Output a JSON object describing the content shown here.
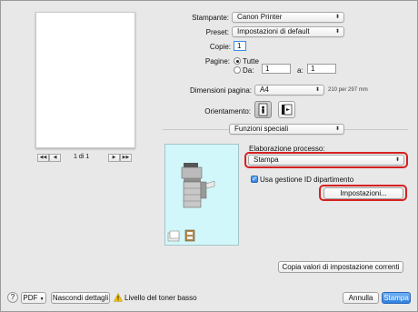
{
  "printer": {
    "label": "Stampante:",
    "value": "Canon Printer"
  },
  "preset": {
    "label": "Preset:",
    "value": "Impostazioni di default"
  },
  "copies": {
    "label": "Copie:",
    "value": "1"
  },
  "pages": {
    "label": "Pagine:",
    "all_label": "Tutte",
    "from_label": "Da:",
    "from_value": "1",
    "to_label": "a:",
    "to_value": "1",
    "selected": "Tutte"
  },
  "paper": {
    "label": "Dimensioni pagina:",
    "value": "A4",
    "size_text": "210 per 297 mm"
  },
  "orientation": {
    "label": "Orientamento:",
    "selected": "portrait"
  },
  "section_popup": {
    "value": "Funzioni speciali"
  },
  "preview": {
    "page_indicator": "1 di 1"
  },
  "processing": {
    "label": "Elaborazione processo:",
    "value": "Stampa"
  },
  "dept_id": {
    "label": "Usa gestione ID dipartimento",
    "checked": true
  },
  "settings_button": "Impostazioni...",
  "copy_values_button": "Copia valori di impostazione correnti",
  "footer": {
    "help": "?",
    "pdf_button": "PDF",
    "hide_details_button": "Nascondi dettagli",
    "toner_warning": "Livello del toner basso",
    "cancel_button": "Annulla",
    "print_button": "Stampa"
  },
  "icons": {
    "warning": "warning-icon",
    "printer": "printer-icon",
    "finisher": "finisher-icon",
    "orient_portrait": "portrait-orientation-icon",
    "orient_landscape": "landscape-orientation-icon"
  },
  "colors": {
    "accent": "#2f7fe0",
    "highlight_ring": "#d62020",
    "panel_bg": "#d2f7fb"
  }
}
